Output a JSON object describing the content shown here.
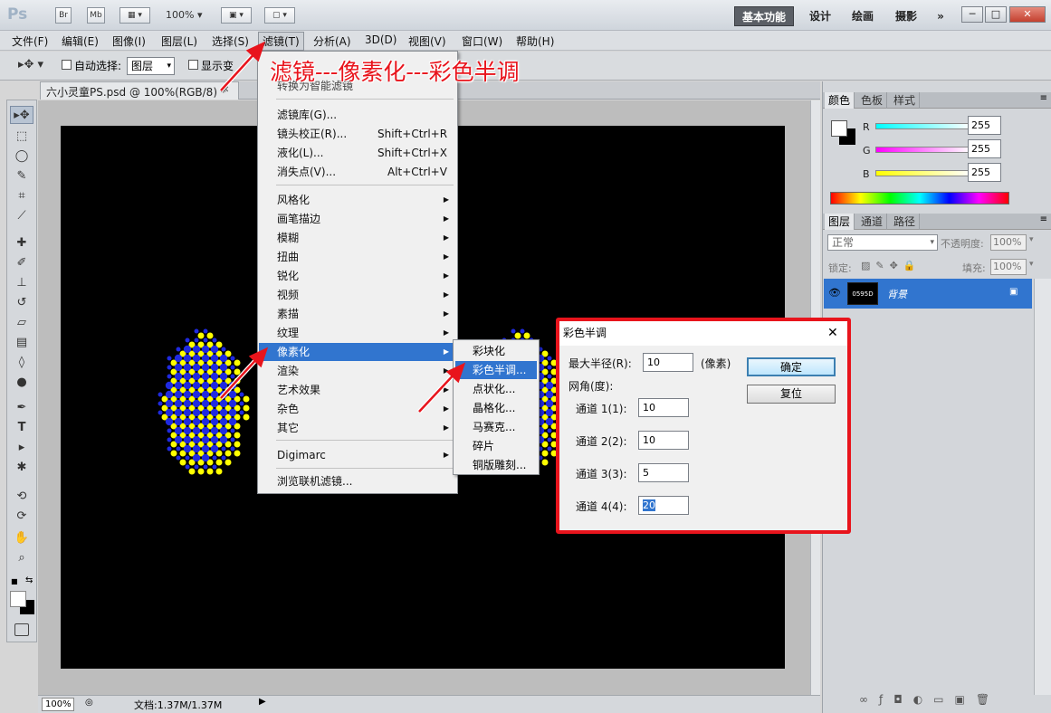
{
  "app": {
    "logo": "Ps",
    "br": "Br",
    "mb": "Mb",
    "zoom": "100%"
  },
  "workspaces": [
    "基本功能",
    "设计",
    "绘画",
    "摄影"
  ],
  "workspace_more": "»",
  "window_buttons": [
    "─",
    "□",
    "✕"
  ],
  "menubar": [
    "文件(F)",
    "编辑(E)",
    "图像(I)",
    "图层(L)",
    "选择(S)",
    "滤镜(T)",
    "分析(A)",
    "3D(D)",
    "视图(V)",
    "窗口(W)",
    "帮助(H)"
  ],
  "options": {
    "autoselect_label": "自动选择:",
    "autoselect_value": "图层",
    "show_transform": "显示变"
  },
  "document": {
    "tab_title": "六小灵童PS.psd @ 100%(RGB/8) *",
    "close": "✕"
  },
  "annotation": "滤镜---像素化---彩色半调",
  "filter_menu": {
    "first_item": "转换为智能滤镜",
    "group1": [
      {
        "label": "滤镜库(G)...",
        "shortcut": ""
      },
      {
        "label": "镜头校正(R)...",
        "shortcut": "Shift+Ctrl+R"
      },
      {
        "label": "液化(L)...",
        "shortcut": "Shift+Ctrl+X"
      },
      {
        "label": "消失点(V)...",
        "shortcut": "Alt+Ctrl+V"
      }
    ],
    "group2": [
      "风格化",
      "画笔描边",
      "模糊",
      "扭曲",
      "锐化",
      "视频",
      "素描",
      "纹理",
      "像素化",
      "渲染",
      "艺术效果",
      "杂色",
      "其它"
    ],
    "group3": [
      "Digimarc"
    ],
    "group4": [
      "浏览联机滤镜..."
    ]
  },
  "pixelate_submenu": [
    "彩块化",
    "彩色半调...",
    "点状化...",
    "晶格化...",
    "马赛克...",
    "碎片",
    "铜版雕刻..."
  ],
  "dialog": {
    "title": "彩色半调",
    "close": "✕",
    "max_radius_label": "最大半径(R):",
    "max_radius_value": "10",
    "unit": "(像素)",
    "angle_label": "网角(度):",
    "channels": [
      {
        "label": "通道 1(1):",
        "value": "10"
      },
      {
        "label": "通道 2(2):",
        "value": "10"
      },
      {
        "label": "通道 3(3):",
        "value": "5"
      },
      {
        "label": "通道 4(4):",
        "value": "20"
      }
    ],
    "ok": "确定",
    "reset": "复位"
  },
  "color_panel": {
    "tabs": [
      "颜色",
      "色板",
      "样式"
    ],
    "r_label": "R",
    "g_label": "G",
    "b_label": "B",
    "r": "255",
    "g": "255",
    "b": "255"
  },
  "layers_panel": {
    "tabs": [
      "图层",
      "通道",
      "路径"
    ],
    "blend": "正常",
    "opacity_label": "不透明度:",
    "opacity": "100%",
    "lock_label": "锁定:",
    "fill_label": "填充:",
    "fill": "100%",
    "layer_name": "背景",
    "thumb_text": "0595D"
  },
  "status": {
    "zoom": "100%",
    "doc": "文档:1.37M/1.37M"
  },
  "colors": {
    "highlight": "#3175cf",
    "annotation": "#e8141c",
    "dot_blue": "#1f2ae0",
    "dot_black": "#0a0a0a",
    "dot_yellow": "#ffff00"
  }
}
